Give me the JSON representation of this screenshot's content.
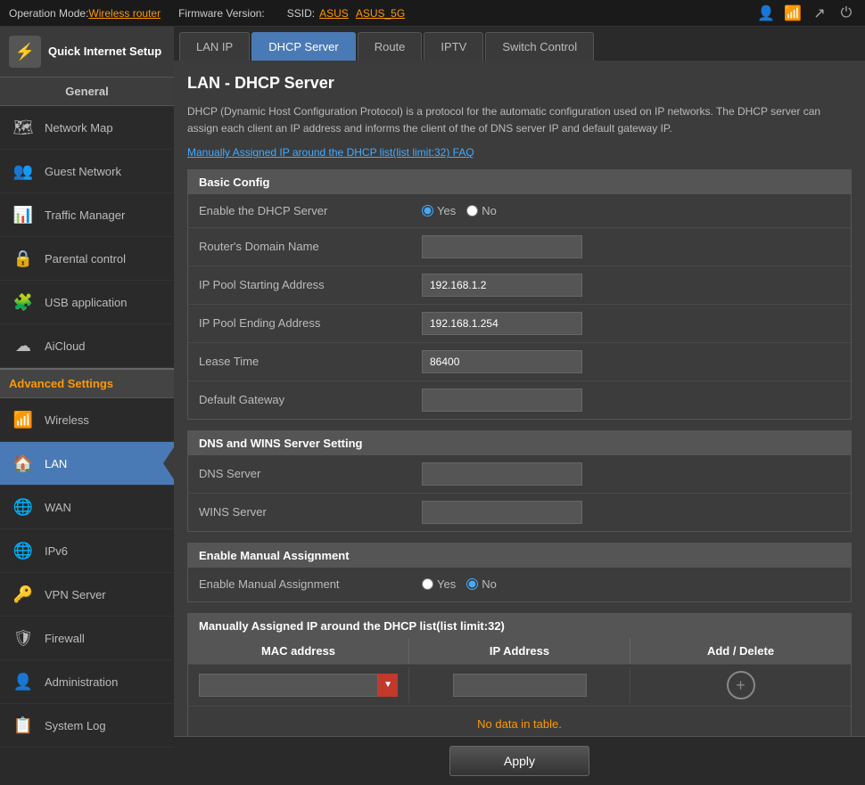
{
  "topbar": {
    "mode_label": "Operation Mode:",
    "mode_value": "Wireless router",
    "fw_label": "Firmware Version:",
    "ssid_label": "SSID:",
    "ssid1": "ASUS",
    "ssid2": "ASUS_5G"
  },
  "sidebar": {
    "quick_setup_label": "Quick Internet Setup",
    "general_header": "General",
    "items_general": [
      {
        "id": "network-map",
        "label": "Network Map",
        "icon": "🗺"
      },
      {
        "id": "guest-network",
        "label": "Guest Network",
        "icon": "👥"
      },
      {
        "id": "traffic-manager",
        "label": "Traffic Manager",
        "icon": "📊"
      },
      {
        "id": "parental-control",
        "label": "Parental control",
        "icon": "🔒"
      },
      {
        "id": "usb-application",
        "label": "USB application",
        "icon": "🧩"
      },
      {
        "id": "aicloud",
        "label": "AiCloud",
        "icon": "☁"
      }
    ],
    "adv_header": "Advanced Settings",
    "items_adv": [
      {
        "id": "wireless",
        "label": "Wireless",
        "icon": "📶"
      },
      {
        "id": "lan",
        "label": "LAN",
        "icon": "🏠",
        "active": true
      },
      {
        "id": "wan",
        "label": "WAN",
        "icon": "🌐"
      },
      {
        "id": "ipv6",
        "label": "IPv6",
        "icon": "🌐"
      },
      {
        "id": "vpn-server",
        "label": "VPN Server",
        "icon": "🔑"
      },
      {
        "id": "firewall",
        "label": "Firewall",
        "icon": "🛡"
      },
      {
        "id": "administration",
        "label": "Administration",
        "icon": "👤"
      },
      {
        "id": "system-log",
        "label": "System Log",
        "icon": "📋"
      }
    ]
  },
  "tabs": [
    {
      "id": "lan-ip",
      "label": "LAN IP"
    },
    {
      "id": "dhcp-server",
      "label": "DHCP Server",
      "active": true
    },
    {
      "id": "route",
      "label": "Route"
    },
    {
      "id": "iptv",
      "label": "IPTV"
    },
    {
      "id": "switch-control",
      "label": "Switch Control"
    }
  ],
  "page": {
    "title": "LAN - DHCP Server",
    "description": "DHCP (Dynamic Host Configuration Protocol) is a protocol for the automatic configuration used on IP networks. The DHCP server can assign each client an IP address and informs the client of the of DNS server IP and default gateway IP.",
    "faq_link": "Manually Assigned IP around the DHCP list(list limit:32) FAQ"
  },
  "basic_config": {
    "header": "Basic Config",
    "rows": [
      {
        "label": "Enable the DHCP Server",
        "type": "radio",
        "options": [
          "Yes",
          "No"
        ],
        "selected": "Yes"
      },
      {
        "label": "Router's Domain Name",
        "type": "input",
        "value": ""
      },
      {
        "label": "IP Pool Starting Address",
        "type": "input",
        "value": "192.168.1.2"
      },
      {
        "label": "IP Pool Ending Address",
        "type": "input",
        "value": "192.168.1.254"
      },
      {
        "label": "Lease Time",
        "type": "input",
        "value": "86400"
      },
      {
        "label": "Default Gateway",
        "type": "input",
        "value": ""
      }
    ]
  },
  "dns_wins": {
    "header": "DNS and WINS Server Setting",
    "rows": [
      {
        "label": "DNS Server",
        "type": "input",
        "value": ""
      },
      {
        "label": "WINS Server",
        "type": "input",
        "value": ""
      }
    ]
  },
  "manual_assign": {
    "header": "Enable Manual Assignment",
    "rows": [
      {
        "label": "Enable Manual Assignment",
        "type": "radio",
        "options": [
          "Yes",
          "No"
        ],
        "selected": "No"
      }
    ]
  },
  "manual_table": {
    "header": "Manually Assigned IP around the DHCP list(list limit:32)",
    "columns": [
      "MAC address",
      "IP Address",
      "Add / Delete"
    ],
    "empty_text": "No data in table."
  },
  "buttons": {
    "apply": "Apply"
  }
}
